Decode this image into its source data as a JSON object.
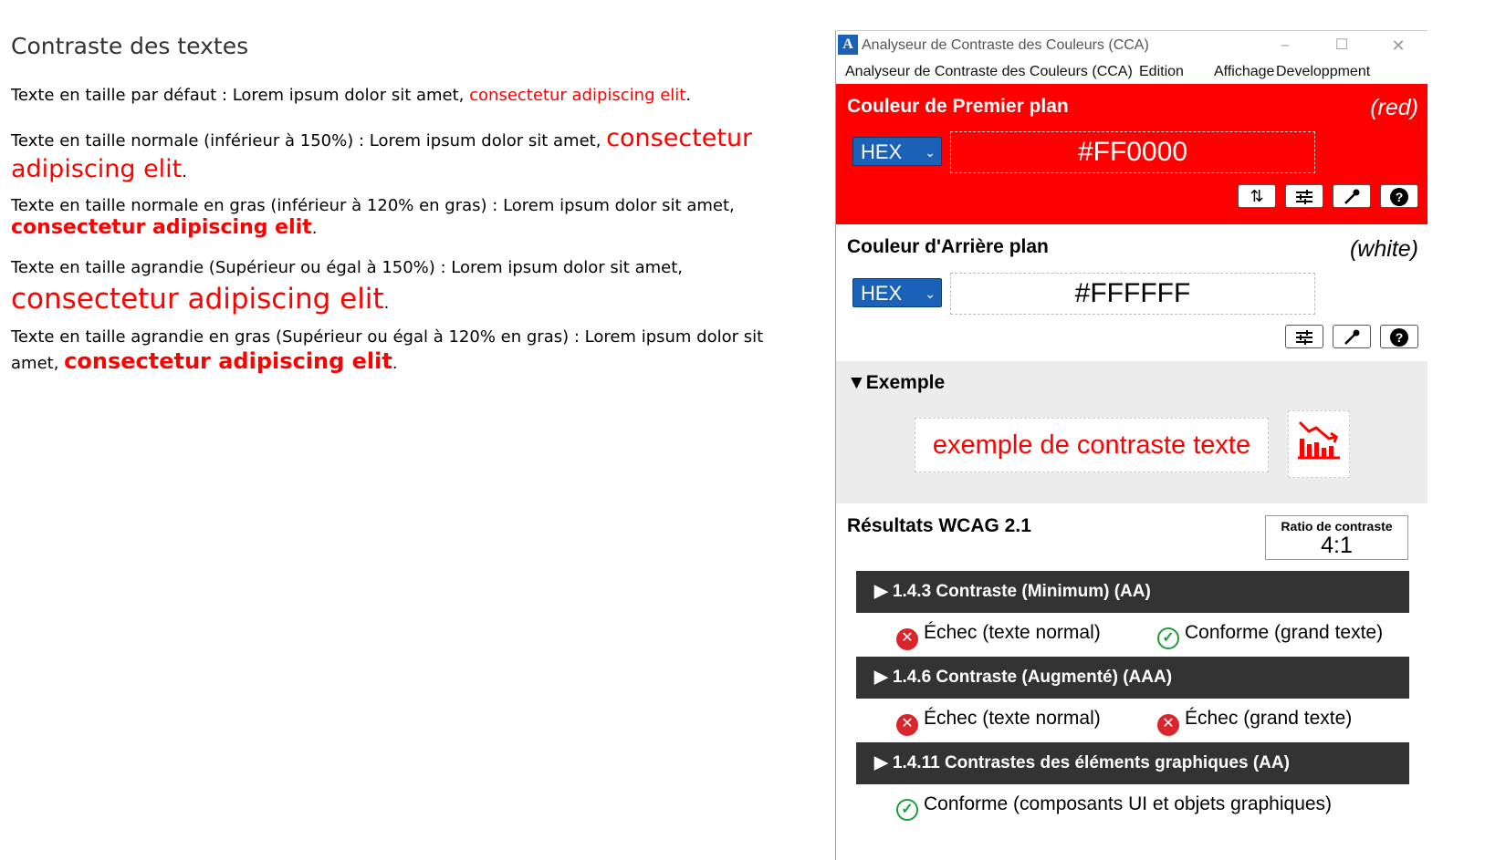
{
  "page": {
    "title": "Contraste des textes",
    "paragraphs": [
      {
        "text": "Texte en taille par défaut : Lorem ipsum dolor sit amet, ",
        "highlight": "consectetur adipiscing elit",
        "end": "."
      },
      {
        "text": "Texte en taille normale (inférieur à 150%) : Lorem ipsum dolor sit amet, ",
        "highlight": "consectetur adipiscing elit",
        "end": "."
      },
      {
        "text": "Texte en taille normale en gras (inférieur à 120% en gras) : Lorem ipsum dolor sit amet, ",
        "highlight": "consectetur adipiscing elit",
        "end": "."
      },
      {
        "text": "Texte en taille agrandie (Supérieur ou égal à 150%) : Lorem ipsum dolor sit amet, ",
        "highlight": "consectetur adipiscing elit",
        "end": "."
      },
      {
        "text": "Texte en taille agrandie en gras (Supérieur ou égal à 120% en gras) : Lorem ipsum dolor sit amet, ",
        "highlight": "consectetur adipiscing elit",
        "end": "."
      }
    ]
  },
  "window": {
    "title": "Analyseur de Contraste des Couleurs (CCA)",
    "controls": {
      "minimize": "–",
      "maximize": "☐",
      "close": "✕"
    },
    "menu": [
      "Analyseur de Contraste des Couleurs (CCA)",
      "Edition",
      "Affichage",
      "Developpment"
    ]
  },
  "foreground": {
    "title": "Couleur de Premier plan",
    "color_name": "(red)",
    "format": "HEX",
    "value": "#FF0000",
    "color": "#ff0000",
    "tools": [
      "swap-icon",
      "adjust-icon",
      "eyedropper-icon",
      "help-icon"
    ]
  },
  "background": {
    "title": "Couleur d'Arrière plan",
    "color_name": "(white)",
    "format": "HEX",
    "value": "#FFFFFF",
    "color": "#ffffff",
    "tools": [
      "adjust-icon",
      "eyedropper-icon",
      "help-icon"
    ]
  },
  "example": {
    "title": "▼Exemple",
    "sample_text": "exemple de contraste texte"
  },
  "results": {
    "title": "Résultats WCAG 2.1",
    "ratio_label": "Ratio de contraste",
    "ratio_value": "4:1",
    "criteria": [
      {
        "label": "▶ 1.4.3 Contraste (Minimum) (AA)",
        "items": [
          {
            "status": "fail",
            "label": "Échec (texte normal)"
          },
          {
            "status": "pass",
            "label": "Conforme (grand texte)"
          }
        ]
      },
      {
        "label": "▶ 1.4.6 Contraste (Augmenté) (AAA)",
        "items": [
          {
            "status": "fail",
            "label": "Échec (texte normal)"
          },
          {
            "status": "fail",
            "label": "Échec (grand texte)"
          }
        ]
      },
      {
        "label": "▶ 1.4.11 Contrastes des éléments graphiques (AA)",
        "items": [
          {
            "status": "pass",
            "label": "Conforme (composants UI et objets graphiques)"
          }
        ]
      }
    ]
  },
  "colors": {
    "accent": "#1a62b7",
    "fail": "#d9262c",
    "pass": "#1a9d3c",
    "header_dark": "#333333"
  }
}
